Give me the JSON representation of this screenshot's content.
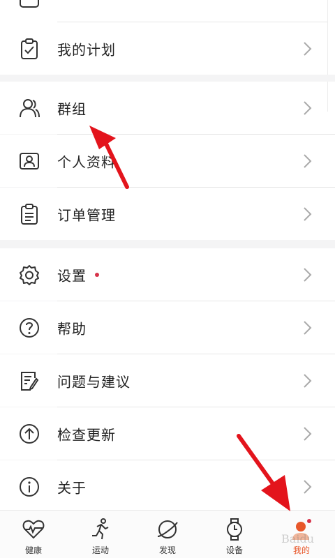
{
  "menu": {
    "group1": [
      {
        "label": "我的计划",
        "icon": "clipboard-check-icon"
      }
    ],
    "group2": [
      {
        "label": "群组",
        "icon": "group-icon"
      },
      {
        "label": "个人资料",
        "icon": "id-card-icon"
      },
      {
        "label": "订单管理",
        "icon": "order-list-icon"
      }
    ],
    "group3": [
      {
        "label": "设置",
        "icon": "gear-icon",
        "badge_dot": true
      },
      {
        "label": "帮助",
        "icon": "question-icon"
      },
      {
        "label": "问题与建议",
        "icon": "feedback-edit-icon"
      },
      {
        "label": "检查更新",
        "icon": "upload-arrow-icon"
      },
      {
        "label": "关于",
        "icon": "info-icon"
      }
    ]
  },
  "tabbar": {
    "tabs": [
      {
        "label": "健康",
        "icon": "heart-pulse-icon"
      },
      {
        "label": "运动",
        "icon": "runner-icon"
      },
      {
        "label": "发现",
        "icon": "planet-icon"
      },
      {
        "label": "设备",
        "icon": "watch-icon"
      },
      {
        "label": "我的",
        "icon": "profile-dot-icon",
        "active": true
      }
    ]
  },
  "colors": {
    "accent": "#e8572a",
    "badge": "#d6334a",
    "annotation_arrow": "#e3141c",
    "background": "#f4f4f5"
  }
}
